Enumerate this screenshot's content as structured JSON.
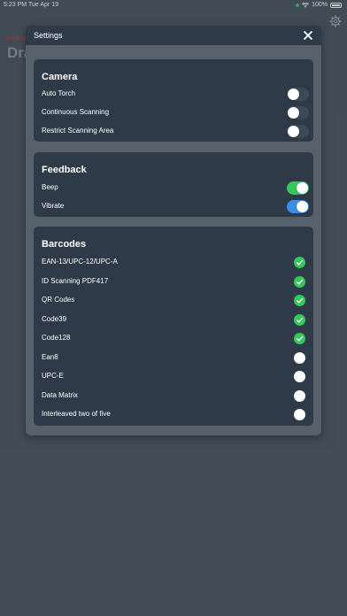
{
  "status_bar": {
    "time": "5:23 PM",
    "date": "Tue Apr 19",
    "battery": "100%"
  },
  "background": {
    "subtitle": "ma Brar",
    "title": "Dra"
  },
  "modal": {
    "title": "Settings",
    "sections": [
      {
        "title": "Camera",
        "items": [
          {
            "label": "Auto Torch",
            "type": "toggle",
            "on": false
          },
          {
            "label": "Continuous Scanning",
            "type": "toggle",
            "on": false
          },
          {
            "label": "Restrict Scanning Area",
            "type": "toggle",
            "on": false
          }
        ]
      },
      {
        "title": "Feedback",
        "items": [
          {
            "label": "Beep",
            "type": "toggle",
            "on": true,
            "color": "#34c759"
          },
          {
            "label": "Vibrate",
            "type": "toggle",
            "on": true,
            "color": "#3a8ee6"
          }
        ]
      },
      {
        "title": "Barcodes",
        "items": [
          {
            "label": "EAN-13/UPC-12/UPC-A",
            "type": "check",
            "on": true
          },
          {
            "label": "ID Scanning PDF417",
            "type": "check",
            "on": true
          },
          {
            "label": "QR Codes",
            "type": "check",
            "on": true
          },
          {
            "label": "Code39",
            "type": "check",
            "on": true
          },
          {
            "label": "Code128",
            "type": "check",
            "on": true
          },
          {
            "label": "Ean8",
            "type": "check",
            "on": false
          },
          {
            "label": "UPC-E",
            "type": "check",
            "on": false
          },
          {
            "label": "Data Matrix",
            "type": "check",
            "on": false
          },
          {
            "label": "Interleaved two of five",
            "type": "check",
            "on": false
          }
        ]
      }
    ]
  }
}
